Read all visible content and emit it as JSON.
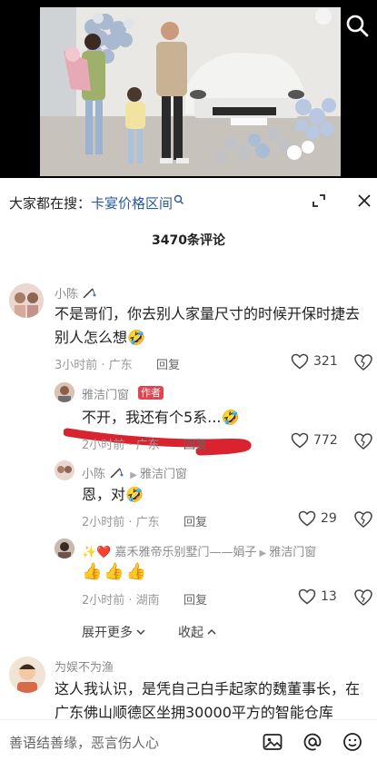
{
  "search": {
    "prefix": "大家都在搜：",
    "query": "卡宴价格区间"
  },
  "comment_count": "3470条评论",
  "comments": [
    {
      "user": "小陈",
      "text": "不是哥们，你去别人家量尺寸的时候开保时捷去别人怎么想",
      "time": "3小时前 · 广东",
      "reply": "回复",
      "likes": "321"
    },
    {
      "user": "雅洁门窗",
      "tag": "作者",
      "text": "不开，我还有个5系...",
      "time": "2小时前 · 广东",
      "reply": "回复",
      "likes": "772"
    },
    {
      "user": "小陈",
      "reply_to": "雅洁门窗",
      "text": "恩，对",
      "time": "2小时前 · 广东",
      "reply": "回复",
      "likes": "29"
    },
    {
      "user": "✨❤️ 嘉禾雅帝乐别墅门——娟子",
      "reply_to": "雅洁门窗",
      "text": "👍👍👍",
      "time": "2小时前 · 湖南",
      "reply": "回复",
      "likes": "13"
    },
    {
      "user": "为娱不为渔",
      "text": "这人我认识，是凭自己白手起家的魏董事长，在广东佛山顺德区坐拥30000平方的智能仓库"
    }
  ],
  "expand_more": "展开更多",
  "collapse": "收起",
  "input": {
    "placeholder": "善语结善缘，恶言伤人心"
  },
  "colors": {
    "link": "#2a5a9c",
    "author_tag": "#e1444f",
    "highlight_stroke": "#d9232e"
  }
}
